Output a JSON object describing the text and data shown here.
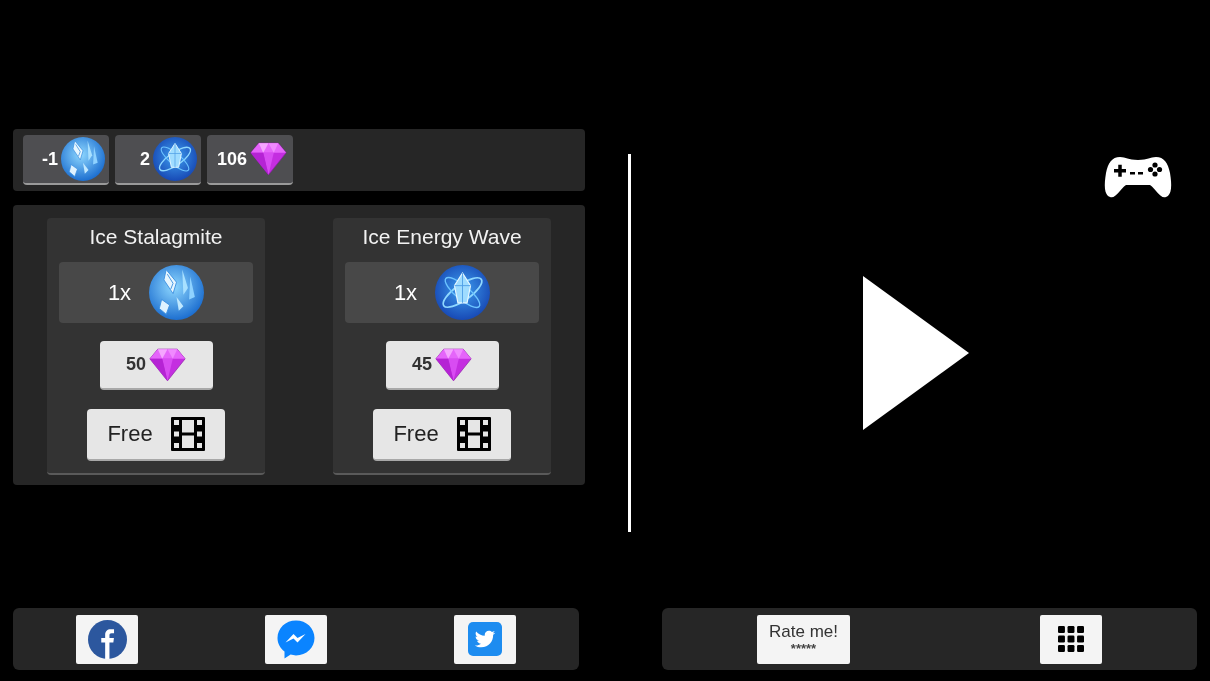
{
  "resources": [
    {
      "kind": "stalagmite",
      "count": "-1"
    },
    {
      "kind": "energy_wave",
      "count": "2"
    },
    {
      "kind": "gem",
      "count": "106"
    }
  ],
  "shop": [
    {
      "title": "Ice Stalagmite",
      "kind": "stalagmite",
      "quantity": "1x",
      "price": "50",
      "free_label": "Free"
    },
    {
      "title": "Ice Energy Wave",
      "kind": "energy_wave",
      "quantity": "1x",
      "price": "45",
      "free_label": "Free"
    }
  ],
  "rate_button": {
    "label": "Rate me!",
    "caption": "*****"
  }
}
